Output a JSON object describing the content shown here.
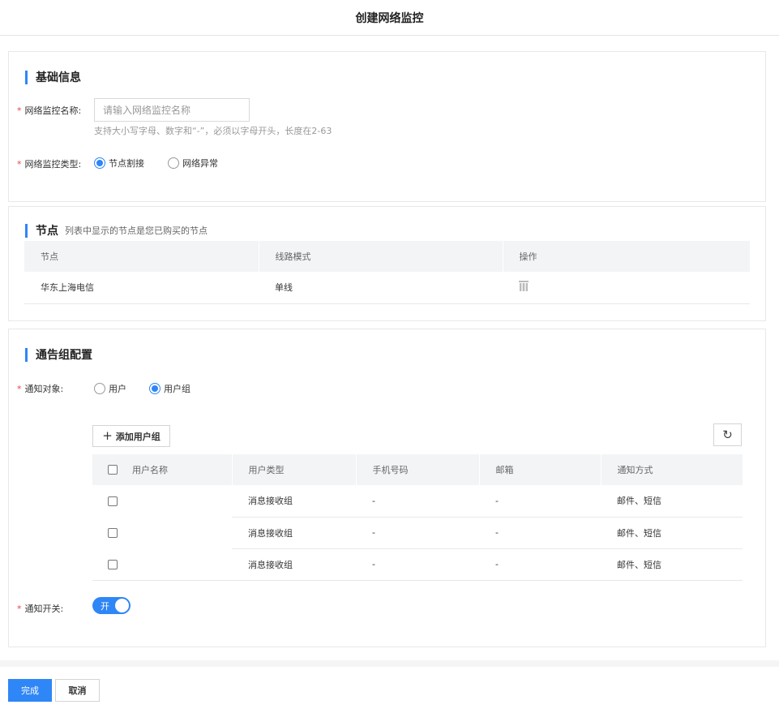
{
  "page": {
    "title": "创建网络监控"
  },
  "basic": {
    "section_title": "基础信息",
    "name_label": "网络监控名称:",
    "name_placeholder": "请输入网络监控名称",
    "name_value": "",
    "name_hint": "支持大小写字母、数字和“-”，必须以字母开头，长度在2-63",
    "type_label": "网络监控类型:",
    "type_options": [
      {
        "label": "节点割接",
        "checked": true
      },
      {
        "label": "网络异常",
        "checked": false
      }
    ]
  },
  "nodes": {
    "section_title": "节点",
    "section_subtitle": "列表中显示的节点是您已购买的节点",
    "columns": [
      "节点",
      "线路模式",
      "操作"
    ],
    "rows": [
      {
        "node": "华东上海电信",
        "mode": "单线",
        "action_icon": "trash-icon"
      }
    ]
  },
  "notify": {
    "section_title": "通告组配置",
    "target_label": "通知对象:",
    "target_options": [
      {
        "label": "用户",
        "checked": false
      },
      {
        "label": "用户组",
        "checked": true
      }
    ],
    "add_button": "添加用户组",
    "refresh_icon": "refresh-icon",
    "columns": [
      "用户名称",
      "用户类型",
      "手机号码",
      "邮箱",
      "通知方式"
    ],
    "rows": [
      {
        "name": "",
        "type": "消息接收组",
        "phone": "-",
        "email": "-",
        "method": "邮件、短信"
      },
      {
        "name": "",
        "type": "消息接收组",
        "phone": "-",
        "email": "-",
        "method": "邮件、短信"
      },
      {
        "name": "",
        "type": "消息接收组",
        "phone": "-",
        "email": "-",
        "method": "邮件、短信"
      }
    ],
    "switch_label": "通知开关:",
    "switch_text": "开",
    "switch_on": true
  },
  "footer": {
    "ok_label": "完成",
    "cancel_label": "取消"
  },
  "colors": {
    "accent": "#2f86f6",
    "required": "#e54545"
  }
}
